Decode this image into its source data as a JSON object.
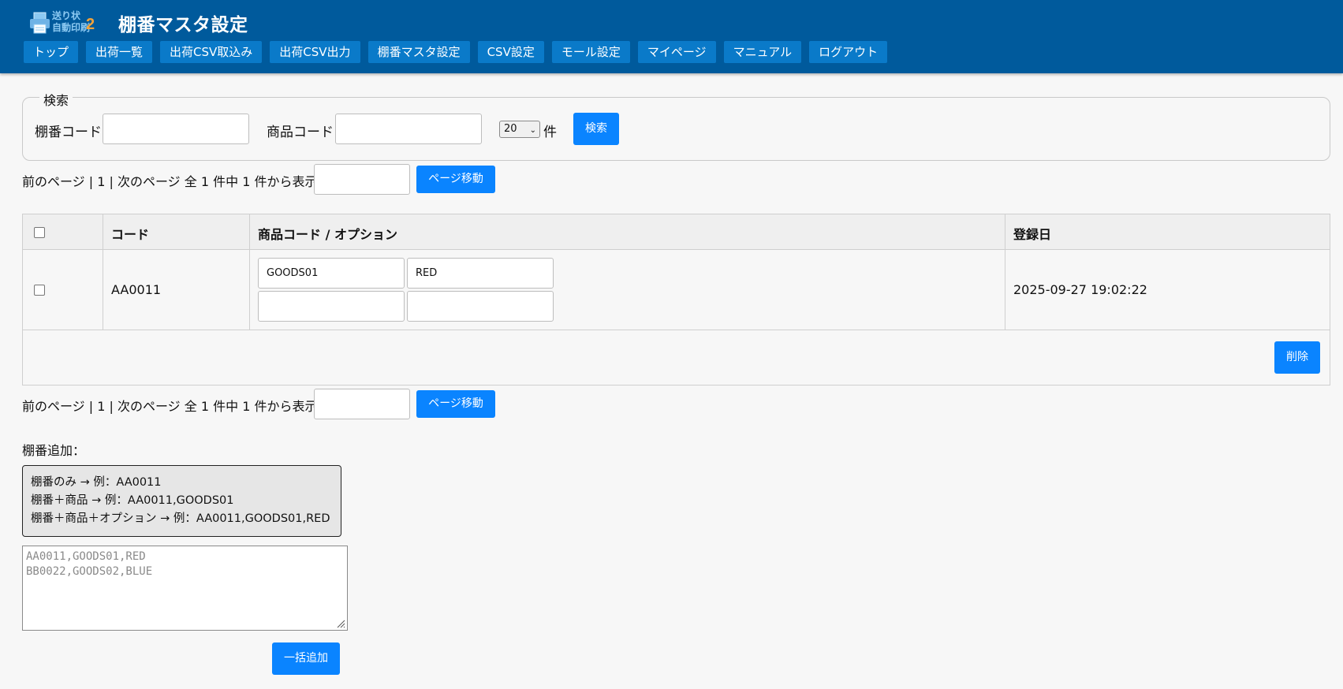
{
  "header": {
    "logo_line1": "送り状",
    "logo_line2": "自動印刷",
    "logo_num": "2",
    "title": "棚番マスタ設定",
    "nav": [
      "トップ",
      "出荷一覧",
      "出荷CSV取込み",
      "出荷CSV出力",
      "棚番マスタ設定",
      "CSV設定",
      "モール設定",
      "マイページ",
      "マニュアル",
      "ログアウト"
    ]
  },
  "search": {
    "legend": "検索",
    "shelf_code_label": "棚番コード",
    "shelf_code_value": "",
    "product_code_label": "商品コード",
    "product_code_value": "",
    "per_page": "20",
    "per_page_unit": "件",
    "search_button": "検索"
  },
  "pager": {
    "text": "前のページ | 1 | 次のページ 全 1 件中 1 件から表示",
    "page_input": "",
    "move_button": "ページ移動"
  },
  "table": {
    "headers": {
      "code": "コード",
      "product": "商品コード / オプション",
      "date": "登録日"
    },
    "rows": [
      {
        "code": "AA0011",
        "product1": "GOODS01",
        "option1": "RED",
        "product2": "",
        "option2": "",
        "date": "2025-09-27 19:02:22"
      }
    ],
    "delete_button": "削除"
  },
  "add": {
    "label": "棚番追加：",
    "examples": [
      "棚番のみ → 例：AA0011",
      "棚番＋商品 → 例：AA0011,GOODS01",
      "棚番＋商品＋オプション → 例：AA0011,GOODS01,RED"
    ],
    "placeholder_line1": "AA0011,GOODS01,RED",
    "placeholder_line2": "BB0022,GOODS02,BLUE",
    "bulk_add_button": "一括追加"
  },
  "colors": {
    "header_bg": "#005a9c",
    "nav_bg": "#0a7ac9",
    "primary": "#0a84ff"
  }
}
